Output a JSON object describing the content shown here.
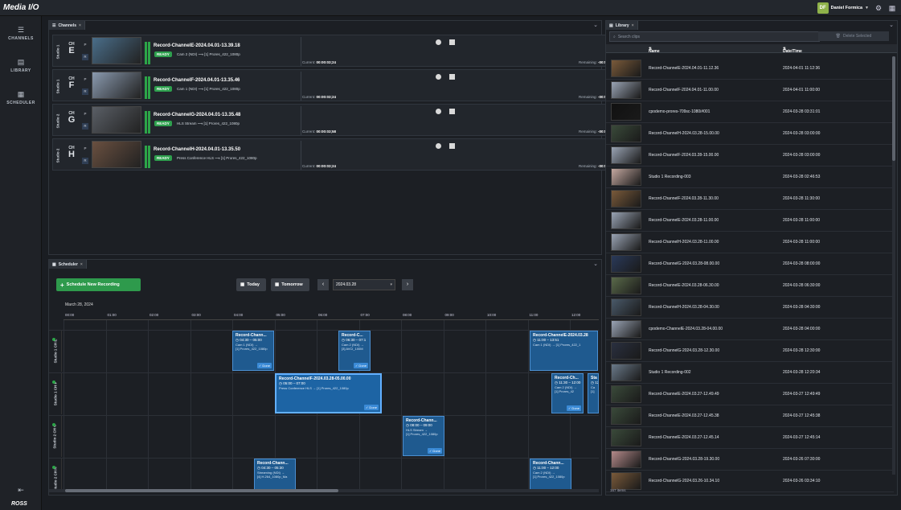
{
  "app": {
    "logo": "Media I/O"
  },
  "user": {
    "initials": "DF",
    "name": "Daniel Formica"
  },
  "nav": [
    {
      "label": "CHANNELS",
      "icon": "channels-icon"
    },
    {
      "label": "LIBRARY",
      "icon": "library-icon"
    },
    {
      "label": "SCHEDULER",
      "icon": "scheduler-icon"
    }
  ],
  "brand": "ROSS",
  "channels_panel": {
    "tab": "Channels",
    "rows": [
      {
        "studio": "Studio 1",
        "ch_prefix": "CH",
        "ch": "E",
        "p": "P",
        "r": "R",
        "name": "Record-ChannelE-2024.04.01-13.39.18",
        "status": "READY",
        "source": "Cam 2 (NDI)",
        "dest": "[1] Prores_422_1080p",
        "current_label": "Current:",
        "current": "00:00:03;24",
        "remaining_label": "Remaining:",
        "remaining": "-00:59:53;29",
        "thumb_color": "#4a6e8a"
      },
      {
        "studio": "Studio 1",
        "ch_prefix": "CH",
        "ch": "F",
        "p": "P",
        "r": "R",
        "name": "Record-ChannelF-2024.04.01-13.35.46",
        "status": "READY",
        "source": "Cam 1 (NDI)",
        "dest": "[1] Prores_422_1080p",
        "current_label": "Current:",
        "current": "00:00:03;24",
        "remaining_label": "Remaining:",
        "remaining": "-00:59:53;29",
        "thumb_color": "#8a9aaf"
      },
      {
        "studio": "Studio 2",
        "ch_prefix": "CH",
        "ch": "G",
        "p": "P",
        "r": "R",
        "name": "Record-ChannelG-2024.04.01-13.35.48",
        "status": "READY",
        "source": "HLS Stream",
        "dest": "[1] Prores_422_1080p",
        "current_label": "Current:",
        "current": "00:00:03;58",
        "remaining_label": "Remaining:",
        "remaining": "-00:59:53;29",
        "thumb_color": "#5a5f66"
      },
      {
        "studio": "Studio 2",
        "ch_prefix": "CH",
        "ch": "H",
        "p": "P",
        "r": "R",
        "name": "Record-ChannelH-2024.04.01-13.35.50",
        "status": "READY",
        "source": "Press Conference HLS",
        "dest": "[1] Prores_422_1080p",
        "current_label": "Current:",
        "current": "00:00:03;24",
        "remaining_label": "Remaining:",
        "remaining": "-00:59:53;29",
        "thumb_color": "#6a5040"
      }
    ],
    "pages": [
      "1",
      "2"
    ],
    "active_page": 2
  },
  "scheduler_panel": {
    "tab": "Scheduler",
    "new_btn": "Schedule New Recording",
    "today_btn": "Today",
    "tomorrow_btn": "Tomorrow",
    "date": "2024.03.28",
    "day_label": "March 28, 2024",
    "hours": [
      "00:00",
      "01:00",
      "02:00",
      "03:00",
      "04:00",
      "05:00",
      "06:00",
      "07:00",
      "08:00",
      "09:00",
      "10:00",
      "11:00",
      "12:00"
    ],
    "rows": [
      {
        "studio": "Studio 1",
        "ch": "CH E"
      },
      {
        "studio": "Studio 1",
        "ch": "CH F"
      },
      {
        "studio": "Studio 2",
        "ch": "CH G"
      },
      {
        "studio": "Studio 2",
        "ch": "CH H"
      }
    ],
    "events": [
      {
        "row": 0,
        "title": "Record-Chann...",
        "time": "04:30 – 05:00",
        "l1": "Cam 1 (NDI) →",
        "l2": "[1] Prores_422_1080p",
        "done": "✓ Done"
      },
      {
        "row": 0,
        "title": "Record-C...",
        "time": "06:30 – 07:1",
        "l1": "Cam 2 (NDI) →",
        "l2": "[3] AVCI_100M",
        "done": "✓ Done"
      },
      {
        "row": 0,
        "title": "Record-ChannelE-2024.03.28",
        "time": "11:00 – 13:51",
        "l1": "Cam 1 (NDI) → [1] Prores_422_1",
        "l2": "",
        "done": ""
      },
      {
        "row": 1,
        "title": "Record-ChannelF-2024.03.28-05.00.00",
        "time": "05:00 – 07:00",
        "l1": "Press Conference HLS → [1] Prores_422_1080p",
        "l2": "",
        "done": "✓ Done"
      },
      {
        "row": 1,
        "title": "Record-Ch...",
        "time": "11:30 – 12:00",
        "l1": "Cam 2 (NDI) →",
        "l2": "[1] Prores_42",
        "done": "✓ Done"
      },
      {
        "row": 1,
        "title": "Sta",
        "time": "12",
        "l1": "Ca",
        "l2": "[1]",
        "done": ""
      },
      {
        "row": 2,
        "title": "Record-Chann...",
        "time": "08:00 – 09:00",
        "l1": "HLS Stream →",
        "l2": "[1] Prores_422_1080p",
        "done": "✓ Done"
      },
      {
        "row": 3,
        "title": "Record-Chann...",
        "time": "04:30 – 05:30",
        "l1": "Streaming (NDI) →",
        "l2": "[4] H.264_1080p_Ma",
        "done": ""
      },
      {
        "row": 3,
        "title": "Record-Chann...",
        "time": "11:00 – 12:00",
        "l1": "Cam 2 (NDI) →",
        "l2": "[1] Prores_422_1080p",
        "done": ""
      }
    ]
  },
  "library_panel": {
    "tab": "Library",
    "search_placeholder": "Search clips",
    "delete_btn": "Delete Selected",
    "col_name": "Name",
    "col_date": "Date/Time",
    "count": "167 items",
    "items": [
      {
        "name": "Record-ChannelE-2024.04.01-11.12.36",
        "date": "2024-04-01 11:12:36",
        "color": "#7a5a3a"
      },
      {
        "name": "Record-ChannelF-2024.04.01-11.00.00",
        "date": "2024-04-01 11:00:00",
        "color": "#9aa4b4"
      },
      {
        "name": "cpodemo-prores-709sc-1080i#001",
        "date": "2024-03-28 03:31:01",
        "color": "#111111"
      },
      {
        "name": "Record-ChannelH-2024.03.28-15.00.00",
        "date": "2024-03-28 03:00:00",
        "color": "#3a4a3a"
      },
      {
        "name": "Record-ChannelF-2024.03.28-15.00.00",
        "date": "2024-03-28 03:00:00",
        "color": "#9aa4b4"
      },
      {
        "name": "Studio 1 Recording-003",
        "date": "2024-03-28 02:46:53",
        "color": "#c4a8a0"
      },
      {
        "name": "Record-ChannelF-2024.03.28-11.30.00",
        "date": "2024-03-28 11:30:00",
        "color": "#7a5a3a"
      },
      {
        "name": "Record-ChannelE-2024.03.28-11.00.00",
        "date": "2024-03-28 11:00:00",
        "color": "#9aa4b4"
      },
      {
        "name": "Record-ChannelH-2024.03.28-11.00.00",
        "date": "2024-03-28 11:00:00",
        "color": "#9aa4b4"
      },
      {
        "name": "Record-ChannelG-2024.03.28-08.00.00",
        "date": "2024-03-28 08:00:00",
        "color": "#2a3a5a"
      },
      {
        "name": "Record-ChannelE-2024.03.28-06.30.00",
        "date": "2024-03-28 06:30:00",
        "color": "#5a6a4a"
      },
      {
        "name": "Record-ChannelH-2024.03.28-04.30.00",
        "date": "2024-03-28 04:30:00",
        "color": "#4a5a6a"
      },
      {
        "name": "cpodemo-ChannelE-2024.03.28-04.00.00",
        "date": "2024-03-28 04:00:00",
        "color": "#9aa4b4"
      },
      {
        "name": "Record-ChannelG-2024.03.28-12.30.00",
        "date": "2024-03-28 12:30:00",
        "color": "#2a3040"
      },
      {
        "name": "Studio 1 Recording-002",
        "date": "2024-03-28 12:20:34",
        "color": "#6a7a8a"
      },
      {
        "name": "Record-ChannelE-2024.03.27-12.49.49",
        "date": "2024-03-27 12:49:49",
        "color": "#3a4a3a"
      },
      {
        "name": "Record-ChannelE-2024.03.27-12.45.38",
        "date": "2024-03-27 12:45:38",
        "color": "#3a4a3a"
      },
      {
        "name": "Record-ChannelE-2024.03.27-12.45.14",
        "date": "2024-03-27 12:45:14",
        "color": "#3a4a3a"
      },
      {
        "name": "Record-ChannelG-2024.03.28-19.30.00",
        "date": "2024-03-26 07:30:00",
        "color": "#b48a8a"
      },
      {
        "name": "Record-ChannelG-2024.03.26-10.34.10",
        "date": "2024-03-26 03:34:10",
        "color": "#7a5a3a"
      }
    ]
  }
}
